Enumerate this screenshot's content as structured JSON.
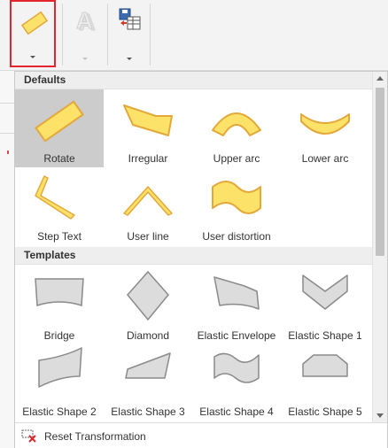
{
  "ribbon": {
    "buttons": [
      {
        "name": "transform-text",
        "icon": "yellow-rotated-box-icon",
        "enabled": true,
        "highlighted": true
      },
      {
        "name": "text-effects",
        "icon": "shadow-letter-a-icon",
        "enabled": false
      },
      {
        "name": "save-layout",
        "icon": "floppy-table-icon",
        "enabled": true
      }
    ]
  },
  "gallery": {
    "sections": [
      {
        "title": "Defaults",
        "items": [
          {
            "label": "Rotate",
            "icon": "rotate-shape-icon",
            "selected": true
          },
          {
            "label": "Irregular",
            "icon": "irregular-shape-icon"
          },
          {
            "label": "Upper arc",
            "icon": "upper-arc-icon"
          },
          {
            "label": "Lower arc",
            "icon": "lower-arc-icon"
          },
          {
            "label": "Step Text",
            "icon": "step-text-icon"
          },
          {
            "label": "User line",
            "icon": "user-line-icon"
          },
          {
            "label": "User distortion",
            "icon": "user-distortion-icon"
          }
        ]
      },
      {
        "title": "Templates",
        "items": [
          {
            "label": "Bridge",
            "icon": "bridge-icon"
          },
          {
            "label": "Diamond",
            "icon": "diamond-icon"
          },
          {
            "label": "Elastic Envelope",
            "icon": "elastic-envelope-icon"
          },
          {
            "label": "Elastic Shape 1",
            "icon": "elastic-shape-1-icon"
          },
          {
            "label": "Elastic Shape 2",
            "icon": "elastic-shape-2-icon"
          },
          {
            "label": "Elastic Shape 3",
            "icon": "elastic-shape-3-icon"
          },
          {
            "label": "Elastic Shape 4",
            "icon": "elastic-shape-4-icon"
          },
          {
            "label": "Elastic Shape 5",
            "icon": "elastic-shape-5-icon"
          }
        ]
      }
    ]
  },
  "footer": {
    "reset_label": "Reset Transformation",
    "icon": "reset-transform-icon"
  },
  "colors": {
    "shape_fill": "#fde26a",
    "shape_stroke": "#e3a83a",
    "template_fill": "#dcdcdc",
    "template_stroke": "#8a8a8a",
    "selected_bg": "#cccccc",
    "highlight_border": "#e3242b"
  }
}
